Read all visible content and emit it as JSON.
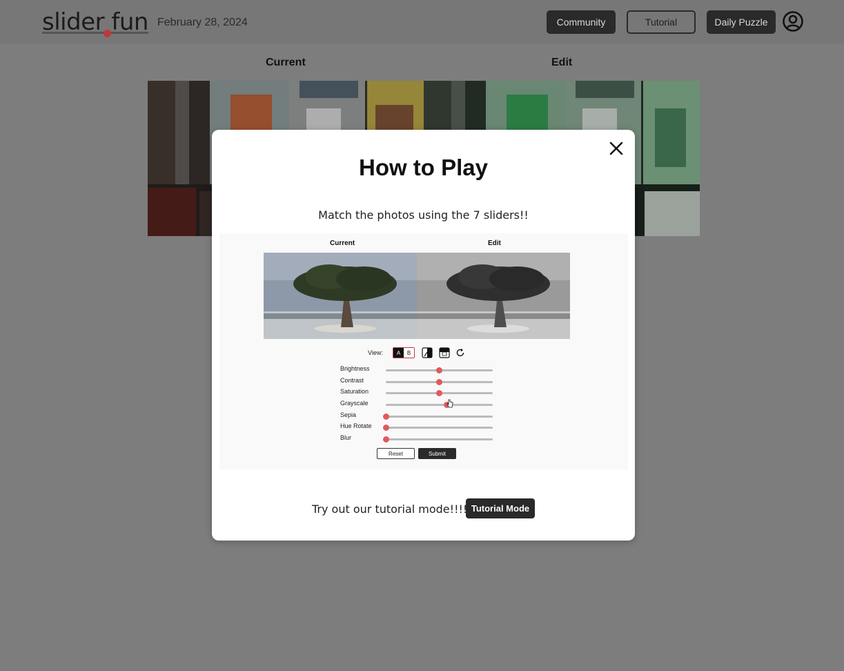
{
  "header": {
    "logo": "slider fun",
    "date": "February 28, 2024",
    "buttons": {
      "community": "Community",
      "tutorial": "Tutorial",
      "daily_puzzle": "Daily Puzzle"
    },
    "user_icon": "user-circle-icon"
  },
  "main": {
    "current_label": "Current",
    "edit_label": "Edit"
  },
  "modal": {
    "title": "How to Play",
    "subtitle": "Match the photos using the 7 sliders!!",
    "close_icon": "close-icon",
    "demo": {
      "current_label": "Current",
      "edit_label": "Edit",
      "view_label": "View:",
      "view_a": "A",
      "view_b": "B",
      "sliders": [
        {
          "name": "Brightness",
          "value": 0.5
        },
        {
          "name": "Contrast",
          "value": 0.5
        },
        {
          "name": "Saturation",
          "value": 0.5
        },
        {
          "name": "Grayscale",
          "value": 0.57
        },
        {
          "name": "Sepia",
          "value": 0.0
        },
        {
          "name": "Hue Rotate",
          "value": 0.0
        },
        {
          "name": "Blur",
          "value": 0.0
        }
      ],
      "reset": "Reset",
      "submit": "Submit"
    },
    "tutorial_prompt": "Try out our tutorial mode!!!! ->",
    "tutorial_button": "Tutorial Mode"
  }
}
